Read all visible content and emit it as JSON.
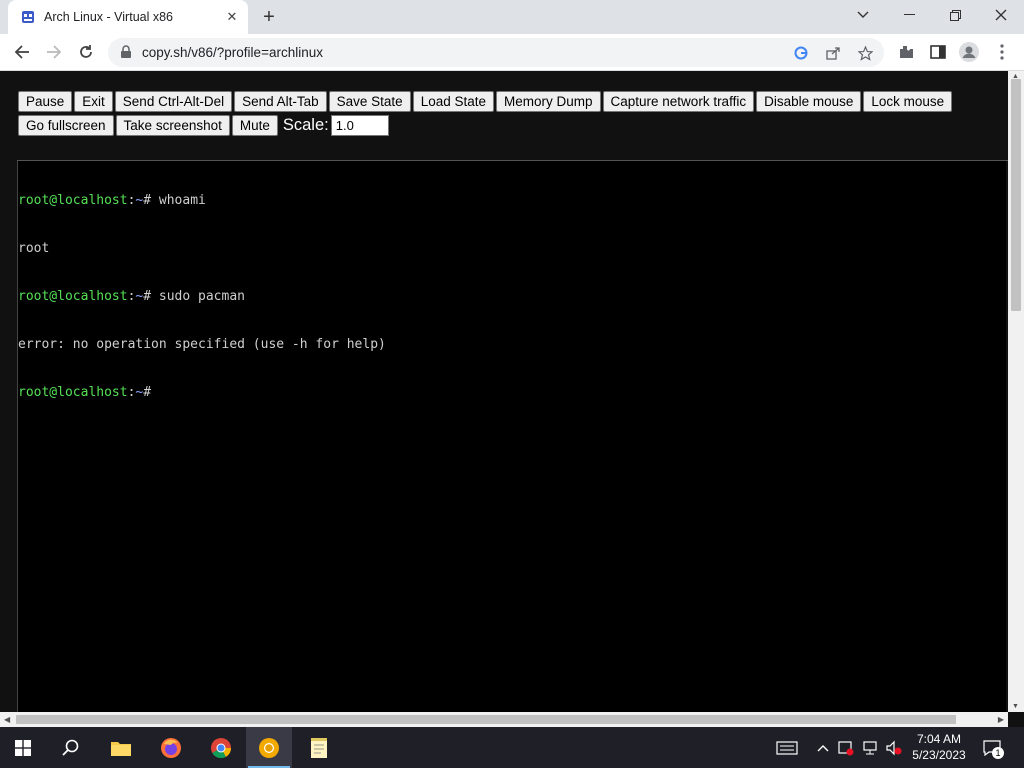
{
  "browser": {
    "tab_title": "Arch Linux - Virtual x86",
    "tab_close": "✕",
    "new_tab": "+",
    "url": "copy.sh/v86/?profile=archlinux"
  },
  "controls": {
    "row1": [
      "Pause",
      "Exit",
      "Send Ctrl-Alt-Del",
      "Send Alt-Tab",
      "Save State",
      "Load State",
      "Memory Dump",
      "Capture network traffic",
      "Disable mouse",
      "Lock mouse"
    ],
    "row2": [
      "Go fullscreen",
      "Take screenshot",
      "Mute"
    ],
    "scale_label": "Scale:",
    "scale_value": "1.0"
  },
  "terminal": {
    "prompt_user": "root@localhost",
    "prompt_sep": ":",
    "prompt_dir": "~",
    "prompt_sym": "#",
    "commands": [
      "whoami",
      "sudo pacman"
    ],
    "outputs": [
      "root",
      "error: no operation specified (use -h for help)"
    ]
  },
  "taskbar": {
    "time": "7:04 AM",
    "date": "5/23/2023",
    "notification_count": "1"
  },
  "colors": {
    "prompt_green": "#55e055",
    "terminal_bg": "#000000",
    "page_bg": "#111111"
  }
}
